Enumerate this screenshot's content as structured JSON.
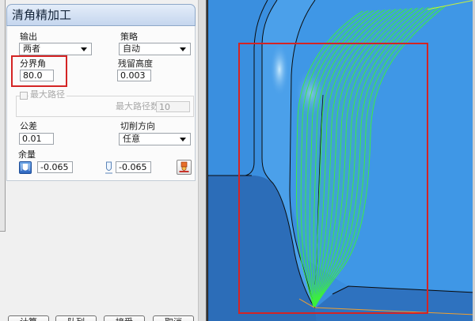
{
  "dialog": {
    "title": "清角精加工",
    "output": {
      "label": "输出",
      "value": "两者"
    },
    "strategy": {
      "label": "策略",
      "value": "自动"
    },
    "boundary_angle": {
      "label": "分界角",
      "value": "80.0"
    },
    "residual_height": {
      "label": "残留高度",
      "value": "0.003"
    },
    "max_paths": {
      "label": "最大路径",
      "checked": false,
      "enabled": false,
      "count_label": "最大路径数",
      "count_value": "10"
    },
    "tolerance": {
      "label": "公差",
      "value": "0.01"
    },
    "cut_direction": {
      "label": "切削方向",
      "value": "任意"
    },
    "allowance": {
      "label": "余量",
      "radial_value": "-0.065",
      "axial_value": "-0.065"
    },
    "buttons": {
      "calculate": "计算",
      "queue": "队列",
      "accept": "接受",
      "cancel": "取消"
    }
  },
  "icons": {
    "dropdown": "dropdown-arrow-icon",
    "radial_allowance": "tool-radial-allowance-icon",
    "axial_allowance": "tool-axial-allowance-icon",
    "allowance_settings": "allowance-settings-icon"
  },
  "viewport": {
    "surface_color": "#3a8fdf",
    "toolpath_color": "#3cf03c",
    "edge_color": "#0b0b0b"
  },
  "annotations": {
    "highlight_color": "#d42424"
  }
}
